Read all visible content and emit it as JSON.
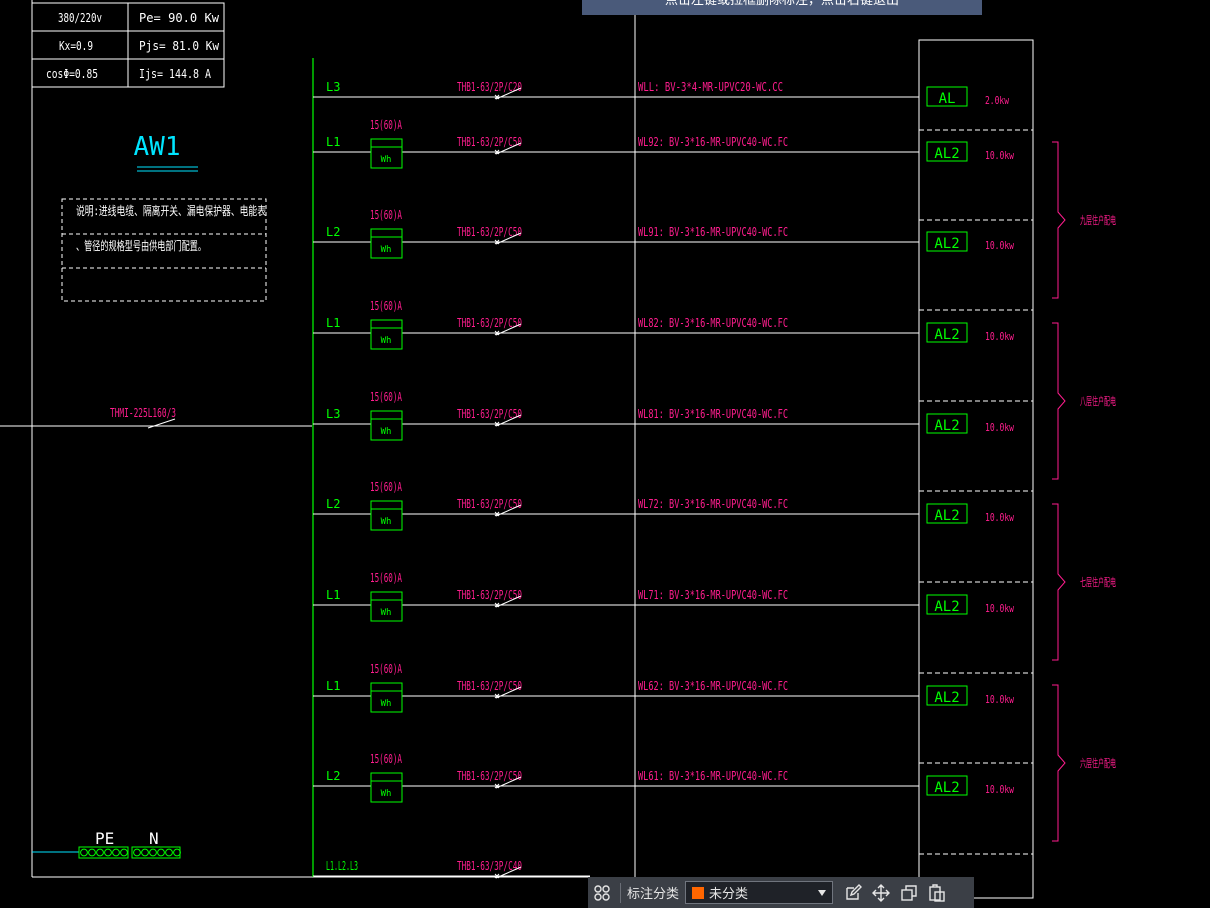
{
  "colors": {
    "white": "#ffffff",
    "green": "#00ff00",
    "magenta": "#ff1d8e",
    "cyan": "#00e5ff",
    "swatch": "#ff6600"
  },
  "hint": {
    "text": "点击左键或拉框删除标注，点击右键退出"
  },
  "info_table": {
    "r1c1": "380/220v",
    "r1c2": "Pe=  90.0  Kw",
    "r2c1": "Kx=0.9",
    "r2c2": "Pjs=  81.0  Kw",
    "r3c1": "cosΦ=0.85",
    "r3c2": "Ijs=  144.8  A"
  },
  "panel": {
    "title": "AW1"
  },
  "note": {
    "line1": "说明:进线电缆、隔离开关、漏电保护器、电能表",
    "line2": "、管径的规格型号由供电部门配置。"
  },
  "main_breaker": {
    "label": "THMI-225L160/3"
  },
  "pe_n": {
    "pe": "PE",
    "n": "N"
  },
  "meter": {
    "symbol": "Wh"
  },
  "circuits": [
    {
      "phase": "L3",
      "meter": "",
      "breaker": "THB1-63/2P/C20",
      "cable": "WLL:  BV-3*4-MR-UPVC20-WC.CC",
      "dest": "AL",
      "kw": "2.0kw"
    },
    {
      "phase": "L1",
      "meter": "15(60)A",
      "breaker": "THB1-63/2P/C50",
      "cable": "WL92:  BV-3*16-MR-UPVC40-WC.FC",
      "dest": "AL2",
      "kw": "10.0kw"
    },
    {
      "phase": "L2",
      "meter": "15(60)A",
      "breaker": "THB1-63/2P/C50",
      "cable": "WL91:  BV-3*16-MR-UPVC40-WC.FC",
      "dest": "AL2",
      "kw": "10.0kw"
    },
    {
      "phase": "L1",
      "meter": "15(60)A",
      "breaker": "THB1-63/2P/C50",
      "cable": "WL82:  BV-3*16-MR-UPVC40-WC.FC",
      "dest": "AL2",
      "kw": "10.0kw"
    },
    {
      "phase": "L3",
      "meter": "15(60)A",
      "breaker": "THB1-63/2P/C50",
      "cable": "WL81:  BV-3*16-MR-UPVC40-WC.FC",
      "dest": "AL2",
      "kw": "10.0kw"
    },
    {
      "phase": "L2",
      "meter": "15(60)A",
      "breaker": "THB1-63/2P/C50",
      "cable": "WL72:  BV-3*16-MR-UPVC40-WC.FC",
      "dest": "AL2",
      "kw": "10.0kw"
    },
    {
      "phase": "L1",
      "meter": "15(60)A",
      "breaker": "THB1-63/2P/C50",
      "cable": "WL71:  BV-3*16-MR-UPVC40-WC.FC",
      "dest": "AL2",
      "kw": "10.0kw"
    },
    {
      "phase": "L1",
      "meter": "15(60)A",
      "breaker": "THB1-63/2P/C50",
      "cable": "WL62:  BV-3*16-MR-UPVC40-WC.FC",
      "dest": "AL2",
      "kw": "10.0kw"
    },
    {
      "phase": "L2",
      "meter": "15(60)A",
      "breaker": "THB1-63/2P/C50",
      "cable": "WL61:  BV-3*16-MR-UPVC40-WC.FC",
      "dest": "AL2",
      "kw": "10.0kw"
    },
    {
      "phase": "L1.L2.L3",
      "meter": "",
      "breaker": "THB1-63/3P/C40",
      "cable": "",
      "dest": "",
      "kw": ""
    }
  ],
  "floors": [
    {
      "label": "九层住户配电"
    },
    {
      "label": "八层住户配电"
    },
    {
      "label": "七层住户配电"
    },
    {
      "label": "六层住户配电"
    }
  ],
  "toolbar": {
    "label": "标注分类",
    "select_value": "未分类",
    "icons": [
      "grid-icon",
      "edit-icon",
      "move-icon",
      "copy-icon",
      "paste-icon"
    ]
  }
}
